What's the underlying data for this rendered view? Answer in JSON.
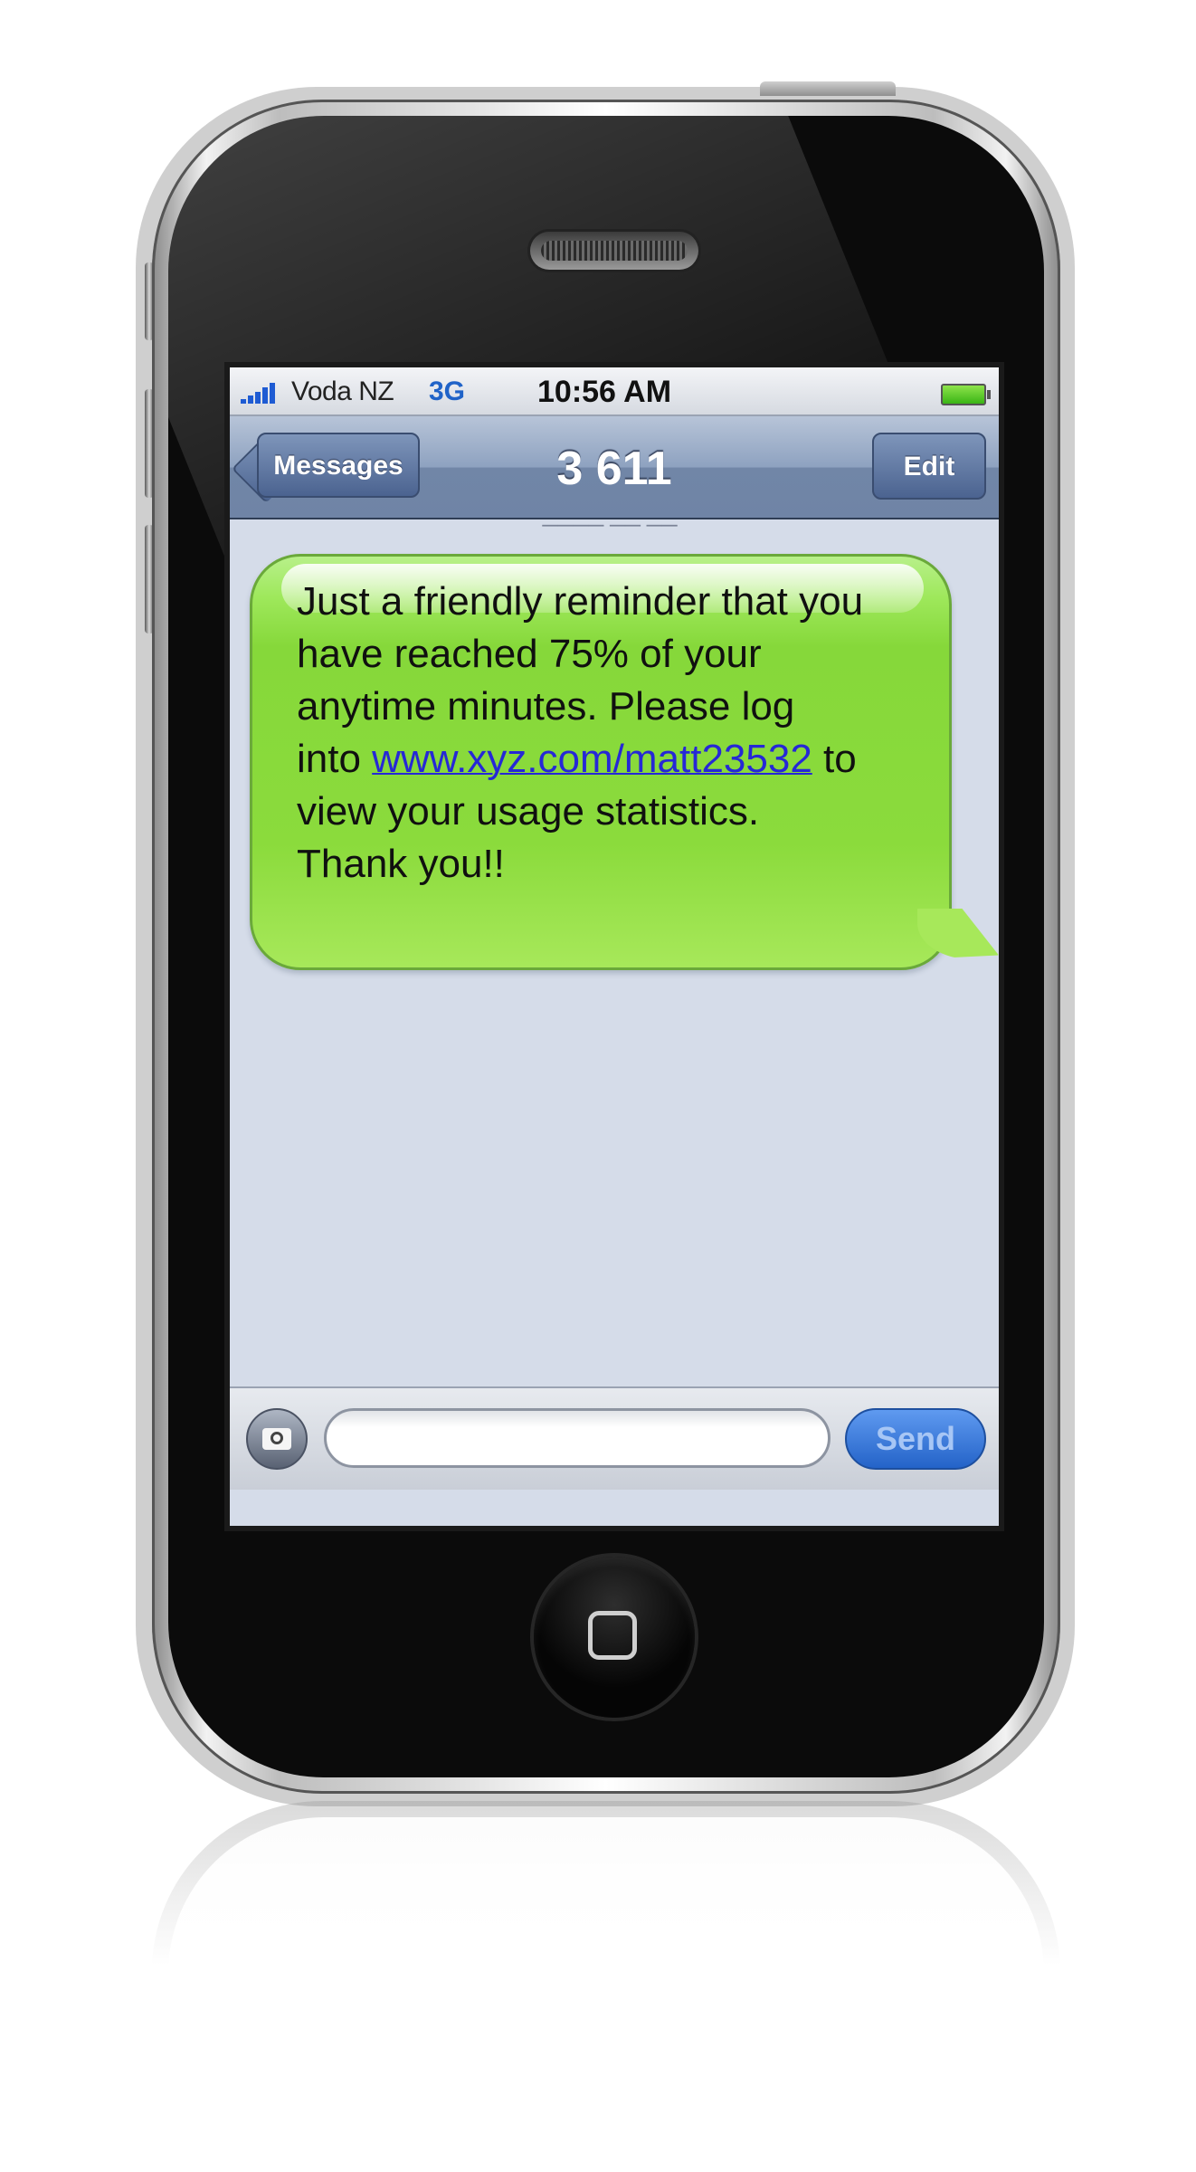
{
  "status_bar": {
    "carrier": "Voda NZ",
    "network": "3G",
    "time": "10:56 AM",
    "signal_bars": 5,
    "battery_level": 1.0
  },
  "nav": {
    "back_label": "Messages",
    "title": "3 611",
    "edit_label": "Edit"
  },
  "thread": {
    "message": {
      "text_before_link": "Just a friendly reminder that you\nhave reached 75% of your\nanytime minutes. Please log\ninto ",
      "link": "www.xyz.com/matt23532",
      "text_after_link": " to\nview your usage statistics.\nThank you!!"
    }
  },
  "compose": {
    "input_value": "",
    "send_label": "Send"
  },
  "colors": {
    "bubble": "#8bdb3c",
    "link": "#2628d6",
    "nav_bar": "#7186a7",
    "send_button": "#2463c8"
  }
}
